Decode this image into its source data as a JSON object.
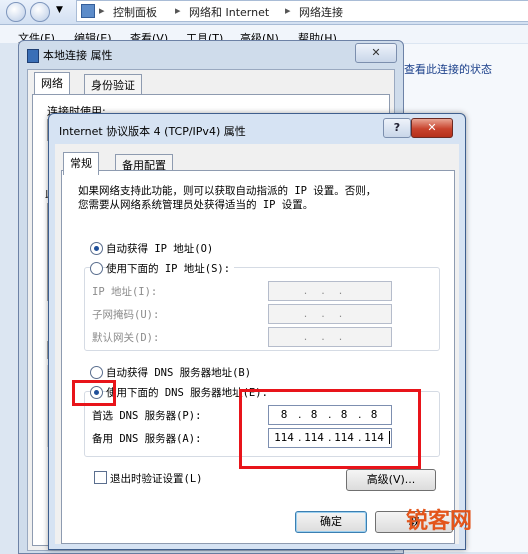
{
  "explorer": {
    "breadcrumbs": [
      "控制面板",
      "网络和 Internet",
      "网络连接"
    ],
    "menu": [
      "文件(F)",
      "编辑(E)",
      "查看(V)",
      "工具(T)",
      "高级(N)",
      "帮助(H)"
    ],
    "status_link": "查看此连接的状态"
  },
  "outer_dialog": {
    "title": "本地连接 属性",
    "tabs": [
      "网络",
      "身份验证"
    ],
    "partial_label_1": "连接时使用:",
    "partial_label_2": "此"
  },
  "inner_dialog": {
    "title": "Internet 协议版本 4 (TCP/IPv4) 属性",
    "tabs": [
      "常规",
      "备用配置"
    ],
    "intro": [
      "如果网络支持此功能，则可以获取自动指派的 IP 设置。否则，",
      "您需要从网络系统管理员处获得适当的 IP 设置。"
    ],
    "ip_auto": "自动获得 IP 地址(O)",
    "ip_manual": "使用下面的 IP 地址(S):",
    "ip_fields": [
      "IP 地址(I):",
      "子网掩码(U):",
      "默认网关(D):"
    ],
    "dns_auto": "自动获得 DNS 服务器地址(B)",
    "dns_manual": "使用下面的 DNS 服务器地址(E):",
    "dns_preferred_label": "首选 DNS 服务器(P):",
    "dns_alternate_label": "备用 DNS 服务器(A):",
    "dns_preferred": [
      "8",
      "8",
      "8",
      "8"
    ],
    "dns_alternate": [
      "114",
      "114",
      "114",
      "114"
    ],
    "validate_on_exit": "退出时验证设置(L)",
    "advanced_button": "高级(V)...",
    "ok_button": "确定",
    "cancel_button": "取",
    "selected": {
      "ip": "auto",
      "dns": "manual"
    },
    "validate_checked": false
  },
  "watermark": "锐客网",
  "colors": {
    "highlight": "#e8141a",
    "close": "#c8432d"
  }
}
